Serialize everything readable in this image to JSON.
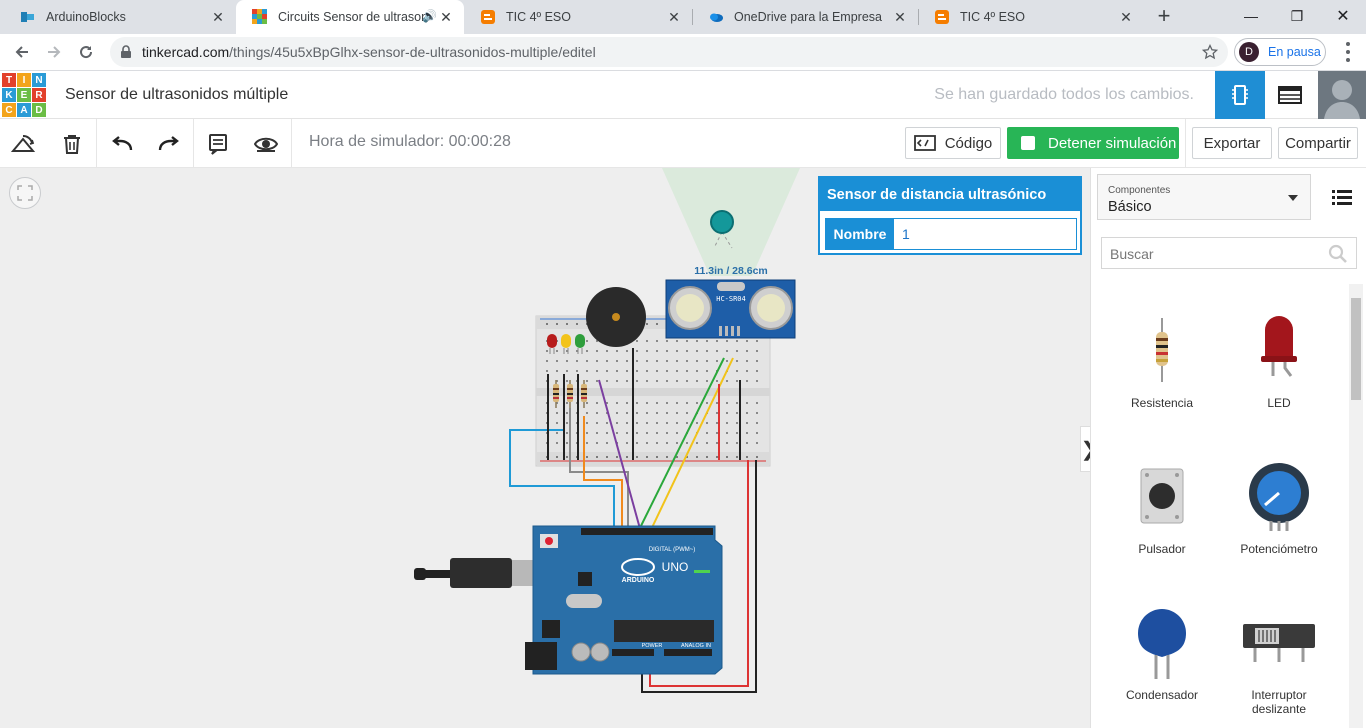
{
  "browser": {
    "tabs": [
      {
        "title": "ArduinoBlocks"
      },
      {
        "title": "Circuits Sensor de ultrason"
      },
      {
        "title": "TIC 4º ESO"
      },
      {
        "title": "OneDrive para la Empresa"
      },
      {
        "title": "TIC 4º ESO"
      }
    ],
    "url_host": "tinkercad.com",
    "url_path": "/things/45u5xBpGlhx-sensor-de-ultrasonidos-multiple/editel",
    "profile_initial": "D",
    "profile_status": "En pausa"
  },
  "tinkercad": {
    "logo_letters": [
      "T",
      "I",
      "N",
      "K",
      "E",
      "R",
      "C",
      "A",
      "D"
    ],
    "project_title": "Sensor de ultrasonidos múltiple",
    "saved_status": "Se han guardado todos los cambios."
  },
  "toolbar": {
    "sim_time": "Hora de simulador: 00:00:28",
    "code_label": "Código",
    "stop_label": "Detener simulación",
    "export_label": "Exportar",
    "share_label": "Compartir"
  },
  "inspector": {
    "title": "Sensor de distancia ultrasónico",
    "name_label": "Nombre",
    "name_value": "1"
  },
  "circuit": {
    "distance_readout": "11.3in / 28.6cm",
    "sensor_model": "HC-SR04",
    "board_brand": "ARDUINO",
    "board_model": "UNO",
    "digital_label": "DIGITAL (PWM~)",
    "power_label": "POWER",
    "analog_label": "ANALOG IN"
  },
  "sidepanel": {
    "components_label": "Componentes",
    "components_value": "Básico",
    "search_placeholder": "Buscar",
    "parts": [
      {
        "label": "Resistencia"
      },
      {
        "label": "LED"
      },
      {
        "label": "Pulsador"
      },
      {
        "label": "Potenciómetro"
      },
      {
        "label": "Condensador"
      },
      {
        "label": "Interruptor deslizante"
      }
    ]
  },
  "colors": {
    "accent": "#1a8fd6",
    "stop_green": "#28b556",
    "arduino_blue": "#2a6fa8"
  }
}
